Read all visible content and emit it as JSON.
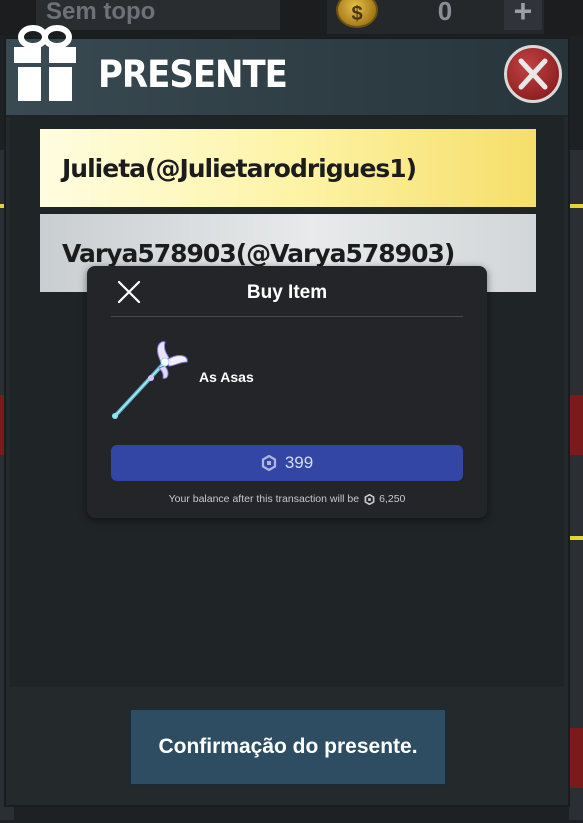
{
  "background": {
    "title": "Sem topo",
    "coin_symbol": "$",
    "coin_count": "0",
    "add_label": "+"
  },
  "dialog": {
    "title": "PRESENTE",
    "close_label": "X",
    "recipients": [
      {
        "label": "Julieta(@Julietarodrigues1)",
        "highlighted": true
      },
      {
        "label": "Varya578903(@Varya578903)",
        "highlighted": false
      }
    ],
    "confirm_label": "Confirmação do presente."
  },
  "purchase_prompt": {
    "title": "Buy Item",
    "item_name": "As Asas",
    "price": "399",
    "balance_text": "Your balance after this transaction will be",
    "balance_value": "6,250"
  },
  "colors": {
    "buy_button": "#3346a6",
    "highlight_row": "#fdf4a8",
    "close_button": "#a52a2e",
    "confirm_button": "#2e4d63"
  }
}
